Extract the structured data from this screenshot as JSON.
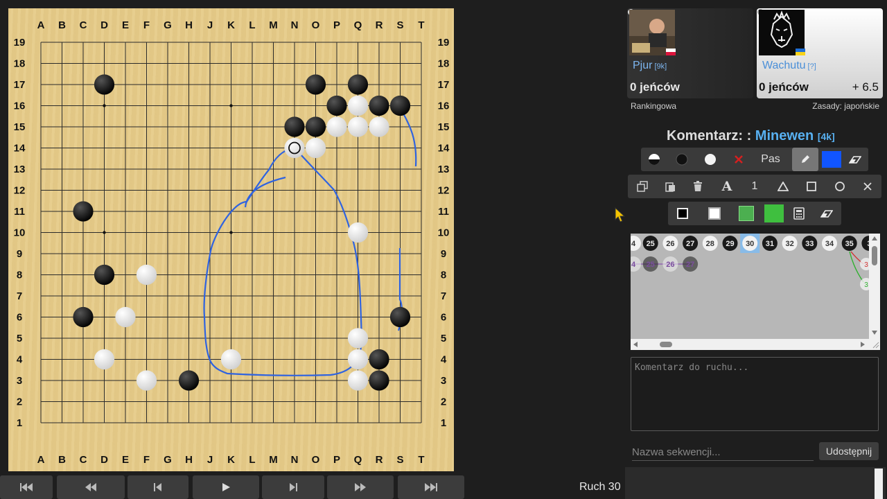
{
  "board": {
    "size": 19,
    "columns": [
      "A",
      "B",
      "C",
      "D",
      "E",
      "F",
      "G",
      "H",
      "J",
      "K",
      "L",
      "M",
      "N",
      "O",
      "P",
      "Q",
      "R",
      "S",
      "T"
    ],
    "rows": [
      "19",
      "18",
      "17",
      "16",
      "15",
      "14",
      "13",
      "12",
      "11",
      "10",
      "9",
      "8",
      "7",
      "6",
      "5",
      "4",
      "3",
      "2",
      "1"
    ],
    "hoshi": [
      "D16",
      "K16",
      "Q16",
      "D10",
      "K10",
      "Q10",
      "D4",
      "K4",
      "Q4"
    ],
    "black_stones": [
      "D17",
      "O17",
      "Q17",
      "P16",
      "R16",
      "S16",
      "N15",
      "O15",
      "C11",
      "D8",
      "C6",
      "S6",
      "R4",
      "H3",
      "R3"
    ],
    "white_stones": [
      "Q16",
      "P15",
      "Q15",
      "R15",
      "N14",
      "O14",
      "Q10",
      "F8",
      "E6",
      "Q5",
      "D4",
      "K4",
      "Q4",
      "F3",
      "Q3"
    ],
    "last_move": "N14",
    "last_move_marker_color": "#111111",
    "drawing_color": "#2f63e0"
  },
  "players": {
    "black": {
      "name": "Pjur",
      "rank": "[9k]",
      "captures": "0 jeńców",
      "name_color": "#7db6f0"
    },
    "white": {
      "name": "Wachutu",
      "rank": "[?]",
      "captures": "0 jeńców",
      "komi": "+ 6.5",
      "name_color": "#4a8fd8"
    }
  },
  "game_type": "Rankingowa",
  "rules": "Zasady: japońskie",
  "review": {
    "label": "Komentarz: :",
    "user": "Minewen",
    "rank": "[4k]"
  },
  "toolbar1": {
    "pass_label": "Pas",
    "selected_color": "#1155ff"
  },
  "toolbar2": {
    "number_label": "1",
    "letter_label": "A"
  },
  "toolbar3": {
    "colors": [
      "#000000",
      "#ffffff",
      "#4caf50",
      "#3fbf3f"
    ]
  },
  "move_tree": {
    "main": [
      "4",
      "25",
      "26",
      "27",
      "28",
      "29",
      "30",
      "31",
      "32",
      "33",
      "34",
      "35",
      "3"
    ],
    "variation": [
      "4",
      "25",
      "26",
      "27"
    ],
    "current": "30",
    "side_labels": [
      "3",
      "3"
    ]
  },
  "comment_placeholder": "Komentarz do ruchu...",
  "sequence_placeholder": "Nazwa sekwencji...",
  "share_label": "Udostępnij",
  "move_label": "Ruch 30",
  "nav_buttons": [
    "first-move",
    "back-10",
    "previous-move",
    "play",
    "next-move",
    "forward-10",
    "last-move"
  ]
}
